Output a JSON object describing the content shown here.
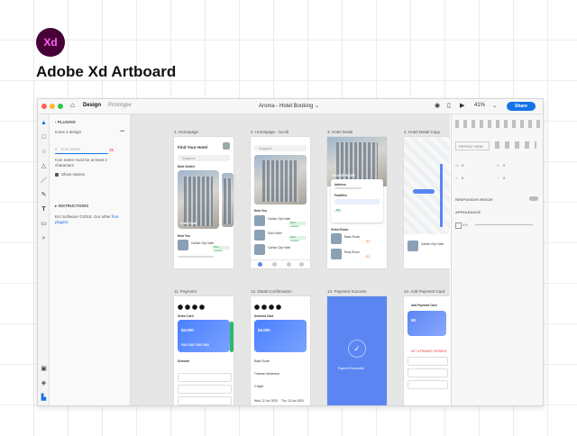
{
  "header": {
    "logo_text": "Xd",
    "title": "Adobe Xd Artboard"
  },
  "titlebar": {
    "tabs": [
      "Design",
      "Prototype"
    ],
    "doc_title": "Aroma - Hotel Booking",
    "zoom": "41%",
    "share_label": "Share"
  },
  "plugins": {
    "header": "PLUGINS",
    "search_label": "Icons 4 design",
    "menu": "•••",
    "icon_name_placeholder": "Icon name",
    "size_value": "36",
    "validation": "Icon name must be at least 2 characters",
    "show_names_label": "Show names",
    "instructions_header": "INSTRUCTIONS",
    "footer_text": "Ení Software ©2019. Our other",
    "footer_link": "fine plugins."
  },
  "artboards": [
    {
      "label": "1. Homepage",
      "heading": "Find Your Hotel",
      "search": "Singapore",
      "most_visited": "Most Visited",
      "near_you": "Near You",
      "overlay": "Grand Hyatt",
      "item": "Carlton City Hotel",
      "tag": "Book available"
    },
    {
      "label": "2. Homepage - Scroll",
      "search": "Singapore",
      "near_you": "Near You",
      "items": [
        "Carlton City Hotel",
        "Shin Farrel",
        "Carlton City Hotel"
      ],
      "tag": "Book available"
    },
    {
      "label": "3. Hotel Detail",
      "title": "Grand Hyatt",
      "address": "Address",
      "facilities": "Facilities",
      "select_room": "Select Room",
      "rooms": [
        "Basic Room",
        "Rosy Room"
      ],
      "price": "$40"
    },
    {
      "label": "4. Hotel Detail Copy",
      "item": "Carlton City Hotel"
    },
    {
      "label": "11. Payment",
      "select_card": "Select Card",
      "balance": "$4.000",
      "card_no": "8888 8888 8888 8888",
      "selected": "Selected"
    },
    {
      "label": "12. Detail Confirmation",
      "select_card": "Selected Card",
      "balance": "$4.000",
      "room": "Basic Room",
      "guest": "Thomas Henderson",
      "nights": "2 Night",
      "checkin": "Wed, 12 Jun 2020",
      "checkout": "Thu, 13 Jun 2020"
    },
    {
      "label": "13. Payment Success",
      "message": "Payment Successful"
    },
    {
      "label": "14. Add Payment Card",
      "title": "Add Payment Card",
      "balance": "$0",
      "primary": "SET A PRIMARY PAYMENT"
    }
  ],
  "props": {
    "responsive": "RESPONSIVE RESIZE",
    "appearance": "APPEARANCE",
    "opacity": "0%",
    "w_label": "W",
    "h_label": "H",
    "x_label": "X",
    "y_label": "Y",
    "w_value": "0",
    "h_value": "0",
    "x_value": "0",
    "y_value": "0",
    "repeat": "REPEAT GRID"
  },
  "colors": {
    "accent": "#1473e6",
    "xd_bg": "#470137",
    "xd_fg": "#ff61f6",
    "success_blue": "#5b86f2"
  }
}
